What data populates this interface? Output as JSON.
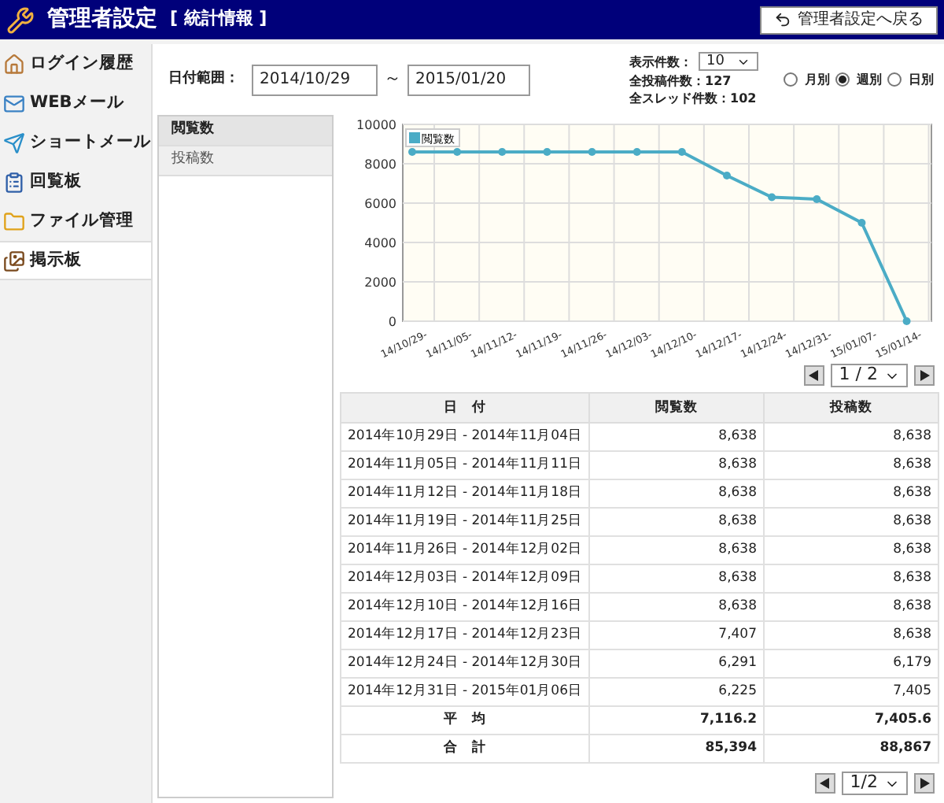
{
  "header": {
    "title": "管理者設定",
    "subtitle": "[ 統計情報 ]",
    "back_button": "管理者設定へ戻る"
  },
  "sidebar": {
    "items": [
      {
        "label": "ログイン履歴",
        "selected": false
      },
      {
        "label": "WEBメール",
        "selected": false
      },
      {
        "label": "ショートメール",
        "selected": false
      },
      {
        "label": "回覧板",
        "selected": false
      },
      {
        "label": "ファイル管理",
        "selected": false
      },
      {
        "label": "掲示板",
        "selected": true
      }
    ]
  },
  "filters": {
    "date_range_label": "日付範囲：",
    "date_from": "2014/10/29",
    "separator": "～",
    "date_to": "2015/01/20",
    "display_count_label": "表示件数：",
    "display_count": "10",
    "total_posts": "全投稿件数：127",
    "total_threads": "全スレッド件数：102",
    "periods": [
      {
        "label": "月別",
        "selected": false
      },
      {
        "label": "週別",
        "selected": true
      },
      {
        "label": "日別",
        "selected": false
      }
    ]
  },
  "metrics": [
    {
      "label": "閲覧数",
      "selected": true
    },
    {
      "label": "投稿数",
      "selected": false
    }
  ],
  "chart": {
    "chart_data": {
      "type": "line",
      "categories": [
        "14/10/29-",
        "14/11/05-",
        "14/11/12-",
        "14/11/19-",
        "14/11/26-",
        "14/12/03-",
        "14/12/10-",
        "14/12/17-",
        "14/12/24-",
        "14/12/31-",
        "15/01/07-",
        "15/01/14-"
      ],
      "series": [
        {
          "name": "閲覧数",
          "color": "#4bacc6",
          "marker": "circle",
          "values": [
            8600,
            8600,
            8600,
            8600,
            8600,
            8600,
            8600,
            7400,
            6300,
            6200,
            5000,
            0
          ]
        }
      ],
      "grid": true,
      "ylim": [
        0,
        10000
      ],
      "yticks": [
        0,
        2000,
        4000,
        6000,
        8000,
        10000
      ]
    },
    "pager": "1 / 2"
  },
  "table": {
    "columns": [
      "日　付",
      "閲覧数",
      "投稿数"
    ],
    "rows": [
      [
        "2014年10月29日 - 2014年11月04日",
        "8,638",
        "8,638"
      ],
      [
        "2014年11月05日 - 2014年11月11日",
        "8,638",
        "8,638"
      ],
      [
        "2014年11月12日 - 2014年11月18日",
        "8,638",
        "8,638"
      ],
      [
        "2014年11月19日 - 2014年11月25日",
        "8,638",
        "8,638"
      ],
      [
        "2014年11月26日 - 2014年12月02日",
        "8,638",
        "8,638"
      ],
      [
        "2014年12月03日 - 2014年12月09日",
        "8,638",
        "8,638"
      ],
      [
        "2014年12月10日 - 2014年12月16日",
        "8,638",
        "8,638"
      ],
      [
        "2014年12月17日 - 2014年12月23日",
        "7,407",
        "8,638"
      ],
      [
        "2014年12月24日 - 2014年12月30日",
        "6,291",
        "6,179"
      ],
      [
        "2014年12月31日 - 2015年01月06日",
        "6,225",
        "7,405"
      ]
    ],
    "summary": [
      [
        "平　均",
        "7,116.2",
        "7,405.6"
      ],
      [
        "合　計",
        "85,394",
        "88,867"
      ]
    ],
    "pager": "1/2"
  }
}
